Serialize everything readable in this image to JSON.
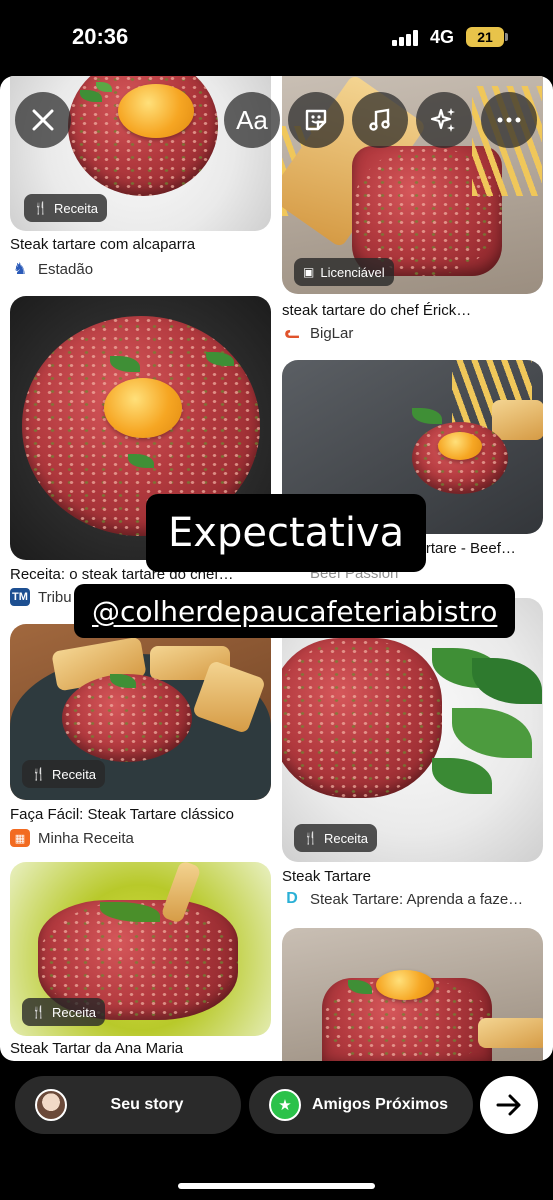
{
  "status_bar": {
    "time": "20:36",
    "network": "4G",
    "battery": "21"
  },
  "editor_controls": [
    {
      "name": "close-button",
      "icon": "close-icon"
    },
    {
      "name": "text-button",
      "label": "Aa"
    },
    {
      "name": "sticker-button",
      "icon": "sticker-icon"
    },
    {
      "name": "music-button",
      "icon": "music-note-icon"
    },
    {
      "name": "effects-button",
      "icon": "sparkles-icon"
    },
    {
      "name": "more-button",
      "icon": "more-dots-icon"
    }
  ],
  "results": {
    "r1": {
      "badge": "Receita",
      "title": "Steak tartare com alcaparra",
      "source": "Estadão"
    },
    "r2": {
      "badge": "Licenciável",
      "title": "steak tartare do chef Érick…",
      "source": "BigLar"
    },
    "r3": {
      "title": "Receita: o steak tartare do chef…",
      "source": "Tribu",
      "source_icon": "TM"
    },
    "r4": {
      "title": "Tartare - Beef…",
      "source": "Beef Passion"
    },
    "r5": {
      "badge": "Receita",
      "title": "Faça Fácil: Steak Tartare clássico",
      "source": "Minha Receita"
    },
    "r6": {
      "badge": "Receita",
      "title": "Steak Tartare",
      "source": "Steak Tartare: Aprenda a faze…"
    },
    "r7": {
      "badge": "Receita",
      "title": "Steak Tartar da Ana Maria"
    }
  },
  "overlay": {
    "headline": "Expectativa",
    "mention": "@colherdepaucafeteriabistro"
  },
  "share": {
    "your_story": "Seu story",
    "close_friends": "Amigos Próximos"
  },
  "colors": {
    "close_friends_green": "#2bc24a",
    "battery": "#e8c34a"
  }
}
